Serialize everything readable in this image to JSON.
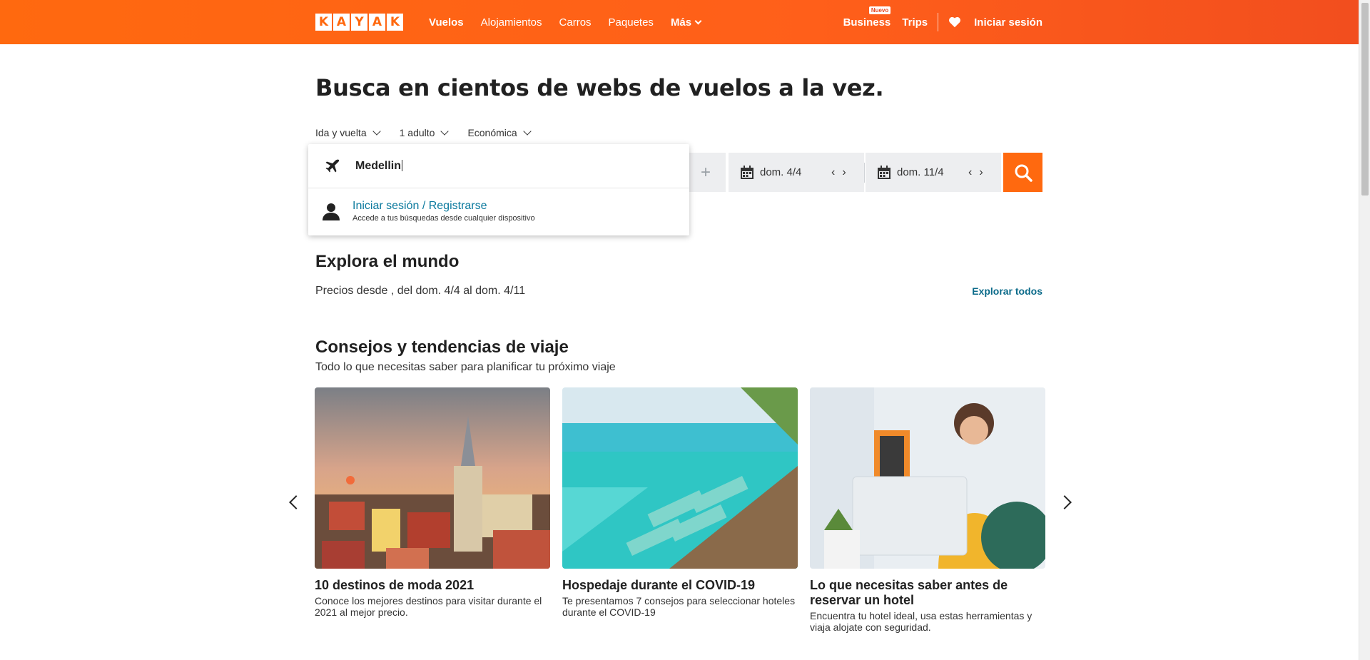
{
  "header": {
    "logo_letters": [
      "K",
      "A",
      "Y",
      "A",
      "K"
    ],
    "nav": [
      {
        "label": "Vuelos",
        "active": true
      },
      {
        "label": "Alojamientos"
      },
      {
        "label": "Carros"
      },
      {
        "label": "Paquetes"
      },
      {
        "label": "Más"
      }
    ],
    "business_label": "Business",
    "business_badge": "Nuevo",
    "trips_label": "Trips",
    "login_label": "Iniciar sesión"
  },
  "search": {
    "headline": "Busca en cientos de webs de vuelos a la vez.",
    "trip_type": "Ida y vuelta",
    "travelers": "1 adulto",
    "cabin": "Económica",
    "origin_value": "Medellin",
    "depart_date": "dom. 4/4",
    "return_date": "dom. 11/4",
    "suggestion": {
      "title": "Iniciar sesión / Registrarse",
      "subtitle": "Accede a tus búsquedas desde cualquier dispositivo"
    }
  },
  "explore": {
    "title": "Explora el mundo",
    "subtitle": "Precios desde , del dom. 4/4 al dom. 4/11",
    "link": "Explorar todos"
  },
  "tips": {
    "title": "Consejos y tendencias de viaje",
    "subtitle": "Todo lo que necesitas saber para planificar tu próximo viaje",
    "cards": [
      {
        "title": "10 destinos de moda 2021",
        "desc": "Conoce los mejores destinos para visitar durante el 2021 al mejor precio."
      },
      {
        "title": "Hospedaje durante el COVID-19",
        "desc": "Te presentamos 7 consejos para seleccionar hoteles durante el COVID-19"
      },
      {
        "title": "Lo que necesitas saber antes de reservar un hotel",
        "desc": "Encuentra tu hotel ideal, usa estas herramientas y viaja alojate con seguridad."
      }
    ]
  },
  "colors": {
    "brand": "#ff690f",
    "link": "#0c7a9e"
  }
}
